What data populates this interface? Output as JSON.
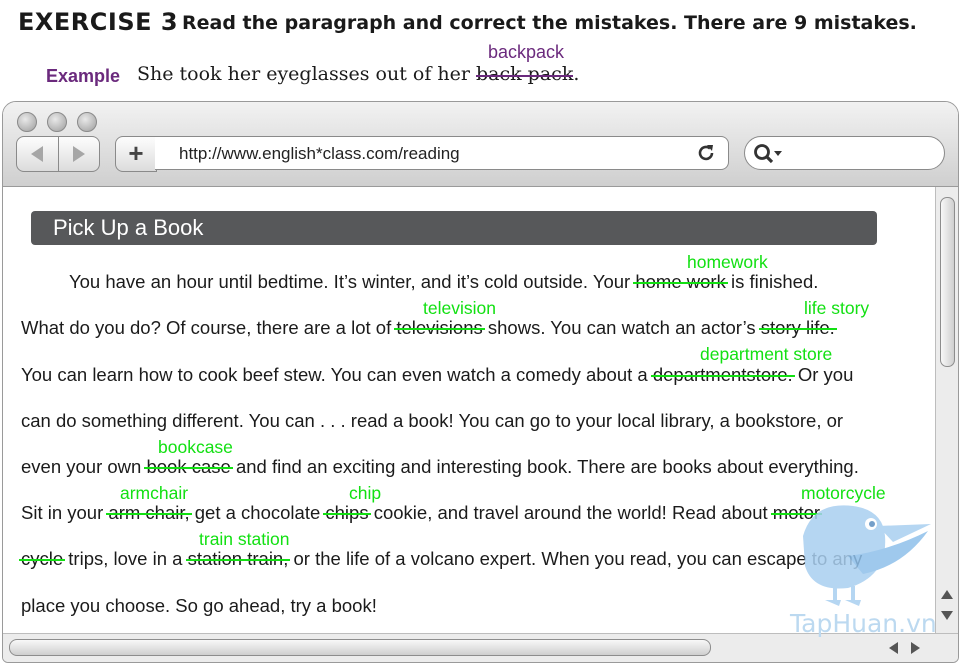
{
  "exercise": {
    "title": "EXERCISE 3",
    "instruction": "Read the paragraph and correct the mistakes. There are 9 mistakes.",
    "example_label": "Example",
    "example_before": "She took her eyeglasses out of her ",
    "example_wrong": "back pack",
    "example_after": ".",
    "example_correction": "backpack"
  },
  "browser": {
    "url": "http://www.english*class.com/reading",
    "nav_back_icon": "back-arrow-icon",
    "nav_forward_icon": "forward-arrow-icon",
    "add_tab_icon": "plus-icon",
    "reload_icon": "reload-icon",
    "search_icon": "search-icon"
  },
  "article": {
    "heading": "Pick Up a Book",
    "l1": {
      "a": "You have an hour until bedtime. It’s winter, and it’s cold outside. Your ",
      "w1": "home work",
      "b": " is finished."
    },
    "l2": {
      "a": "What do you do? Of course, there are a lot of ",
      "w1": "televisions",
      "b": " shows. You can watch an actor’s ",
      "w2": "story life."
    },
    "l3": {
      "a": "You can learn how to cook beef stew. You can even watch a comedy about a ",
      "w1": "departmentstore.",
      "b": " Or you"
    },
    "l4": {
      "a": "can do something different. You can . . . read a book! You can go to your local library, a bookstore, or"
    },
    "l5": {
      "a": "even your own ",
      "w1": "book case",
      "b": " and find an exciting and interesting book. There are books about everything."
    },
    "l6": {
      "a": "Sit in your ",
      "w1": "arm chair,",
      "b": " get a chocolate ",
      "w2": "chips",
      "c": " cookie, and travel around the world! Read about ",
      "w3": "motor"
    },
    "l7": {
      "w1": "cycle",
      "a": " trips, love in a ",
      "w2": "station train,",
      "b": " or the life of a volcano expert. When you read, you can escape to any"
    },
    "l8": {
      "a": "place you choose. So go ahead, try a book!"
    }
  },
  "corrections": {
    "homework": "homework",
    "television": "television",
    "life_story": "life story",
    "department_store": "department store",
    "bookcase": "bookcase",
    "armchair": "armchair",
    "chip": "chip",
    "motorcycle": "motorcycle",
    "train_station": "train station"
  },
  "watermark": {
    "text": "TapHuan.vn"
  },
  "colors": {
    "correction": "#12e012",
    "example": "#6b2a7d",
    "banner": "#57585a"
  }
}
